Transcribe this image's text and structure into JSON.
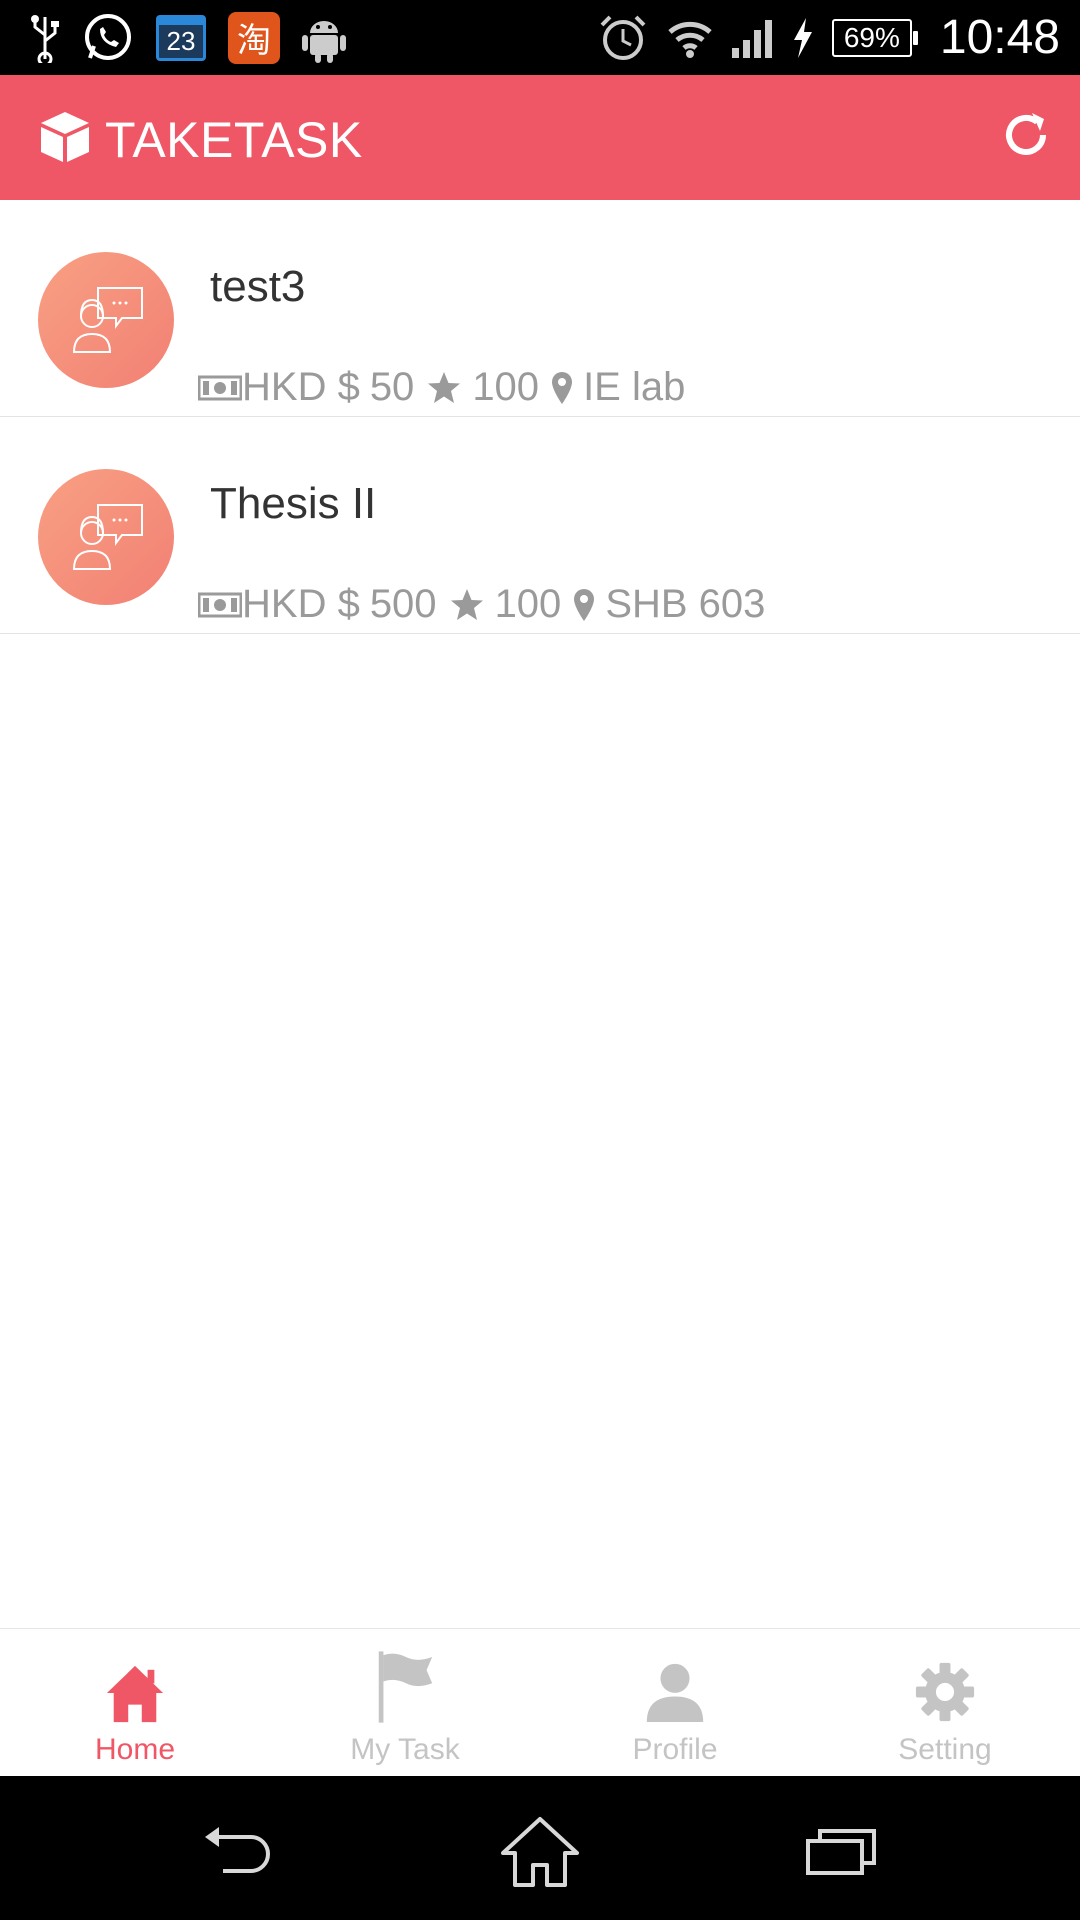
{
  "status_bar": {
    "calendar_day": "23",
    "taobao_glyph": "淘",
    "battery": "69%",
    "time": "10:48",
    "left_icons": [
      "usb-icon",
      "whatsapp-icon",
      "calendar-icon",
      "taobao-icon",
      "android-icon"
    ],
    "right_icons": [
      "alarm-icon",
      "wifi-icon",
      "signal-icon",
      "charging-icon",
      "battery-icon"
    ]
  },
  "app_bar": {
    "title": "TAKETASK",
    "logo_icon": "cube-icon",
    "refresh_icon": "refresh-icon",
    "background": "#ef5766"
  },
  "tasks": [
    {
      "title": "test3",
      "currency": "HKD $",
      "amount": "50",
      "points": "100",
      "location": "IE lab"
    },
    {
      "title": "Thesis II",
      "currency": "HKD $",
      "amount": "500",
      "points": "100",
      "location": "SHB 603"
    }
  ],
  "tabs": [
    {
      "label": "Home",
      "icon": "home-icon",
      "active": true
    },
    {
      "label": "My Task",
      "icon": "flag-icon",
      "active": false
    },
    {
      "label": "Profile",
      "icon": "person-icon",
      "active": false
    },
    {
      "label": "Setting",
      "icon": "gear-icon",
      "active": false
    }
  ],
  "nav_bar": {
    "buttons": [
      "back-icon",
      "home-outline-icon",
      "recents-icon"
    ]
  },
  "colors": {
    "accent": "#ef5766",
    "inactive": "#c4c4c4",
    "meta_text": "#9a9a9a"
  }
}
